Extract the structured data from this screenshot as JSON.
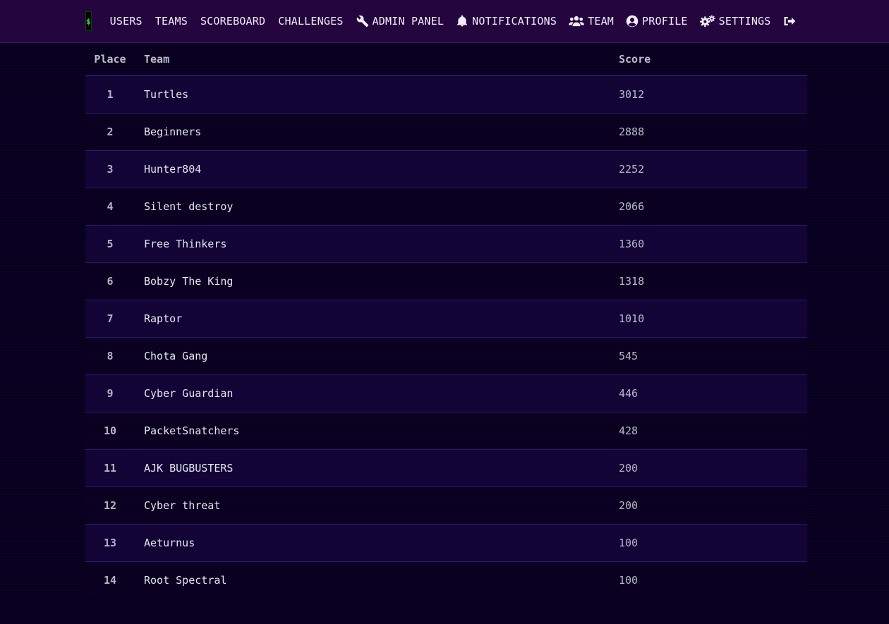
{
  "nav": {
    "logo_text": "$",
    "left_links": [
      {
        "label": "USERS"
      },
      {
        "label": "TEAMS"
      },
      {
        "label": "SCOREBOARD"
      },
      {
        "label": "CHALLENGES"
      }
    ],
    "right_links": [
      {
        "label": "ADMIN PANEL",
        "icon": "wrench-icon"
      },
      {
        "label": "NOTIFICATIONS",
        "icon": "bell-icon"
      },
      {
        "label": "TEAM",
        "icon": "users-icon"
      },
      {
        "label": "PROFILE",
        "icon": "user-circle-icon"
      },
      {
        "label": "SETTINGS",
        "icon": "gears-icon"
      },
      {
        "label": "",
        "icon": "logout-icon"
      }
    ]
  },
  "scoreboard": {
    "headers": {
      "place": "Place",
      "team": "Team",
      "score": "Score"
    },
    "rows": [
      {
        "place": "1",
        "team": "Turtles",
        "score": "3012"
      },
      {
        "place": "2",
        "team": "Beginners",
        "score": "2888"
      },
      {
        "place": "3",
        "team": "Hunter804",
        "score": "2252"
      },
      {
        "place": "4",
        "team": "Silent destroy",
        "score": "2066"
      },
      {
        "place": "5",
        "team": "Free Thinkers",
        "score": "1360"
      },
      {
        "place": "6",
        "team": "Bobzy The King",
        "score": "1318"
      },
      {
        "place": "7",
        "team": "Raptor",
        "score": "1010"
      },
      {
        "place": "8",
        "team": "Chota Gang",
        "score": "545"
      },
      {
        "place": "9",
        "team": "Cyber Guardian",
        "score": "446"
      },
      {
        "place": "10",
        "team": "PacketSnatchers",
        "score": "428"
      },
      {
        "place": "11",
        "team": "AJK BUGBUSTERS",
        "score": "200"
      },
      {
        "place": "12",
        "team": "Cyber threat",
        "score": "200"
      },
      {
        "place": "13",
        "team": "Aeturnus",
        "score": "100"
      },
      {
        "place": "14",
        "team": "Root Spectral",
        "score": "100"
      }
    ]
  },
  "colors": {
    "navbar_bg": "#24053e",
    "page_bg": "#06001a",
    "row_border": "#2b1a6e",
    "logo_green": "#33dd44"
  }
}
